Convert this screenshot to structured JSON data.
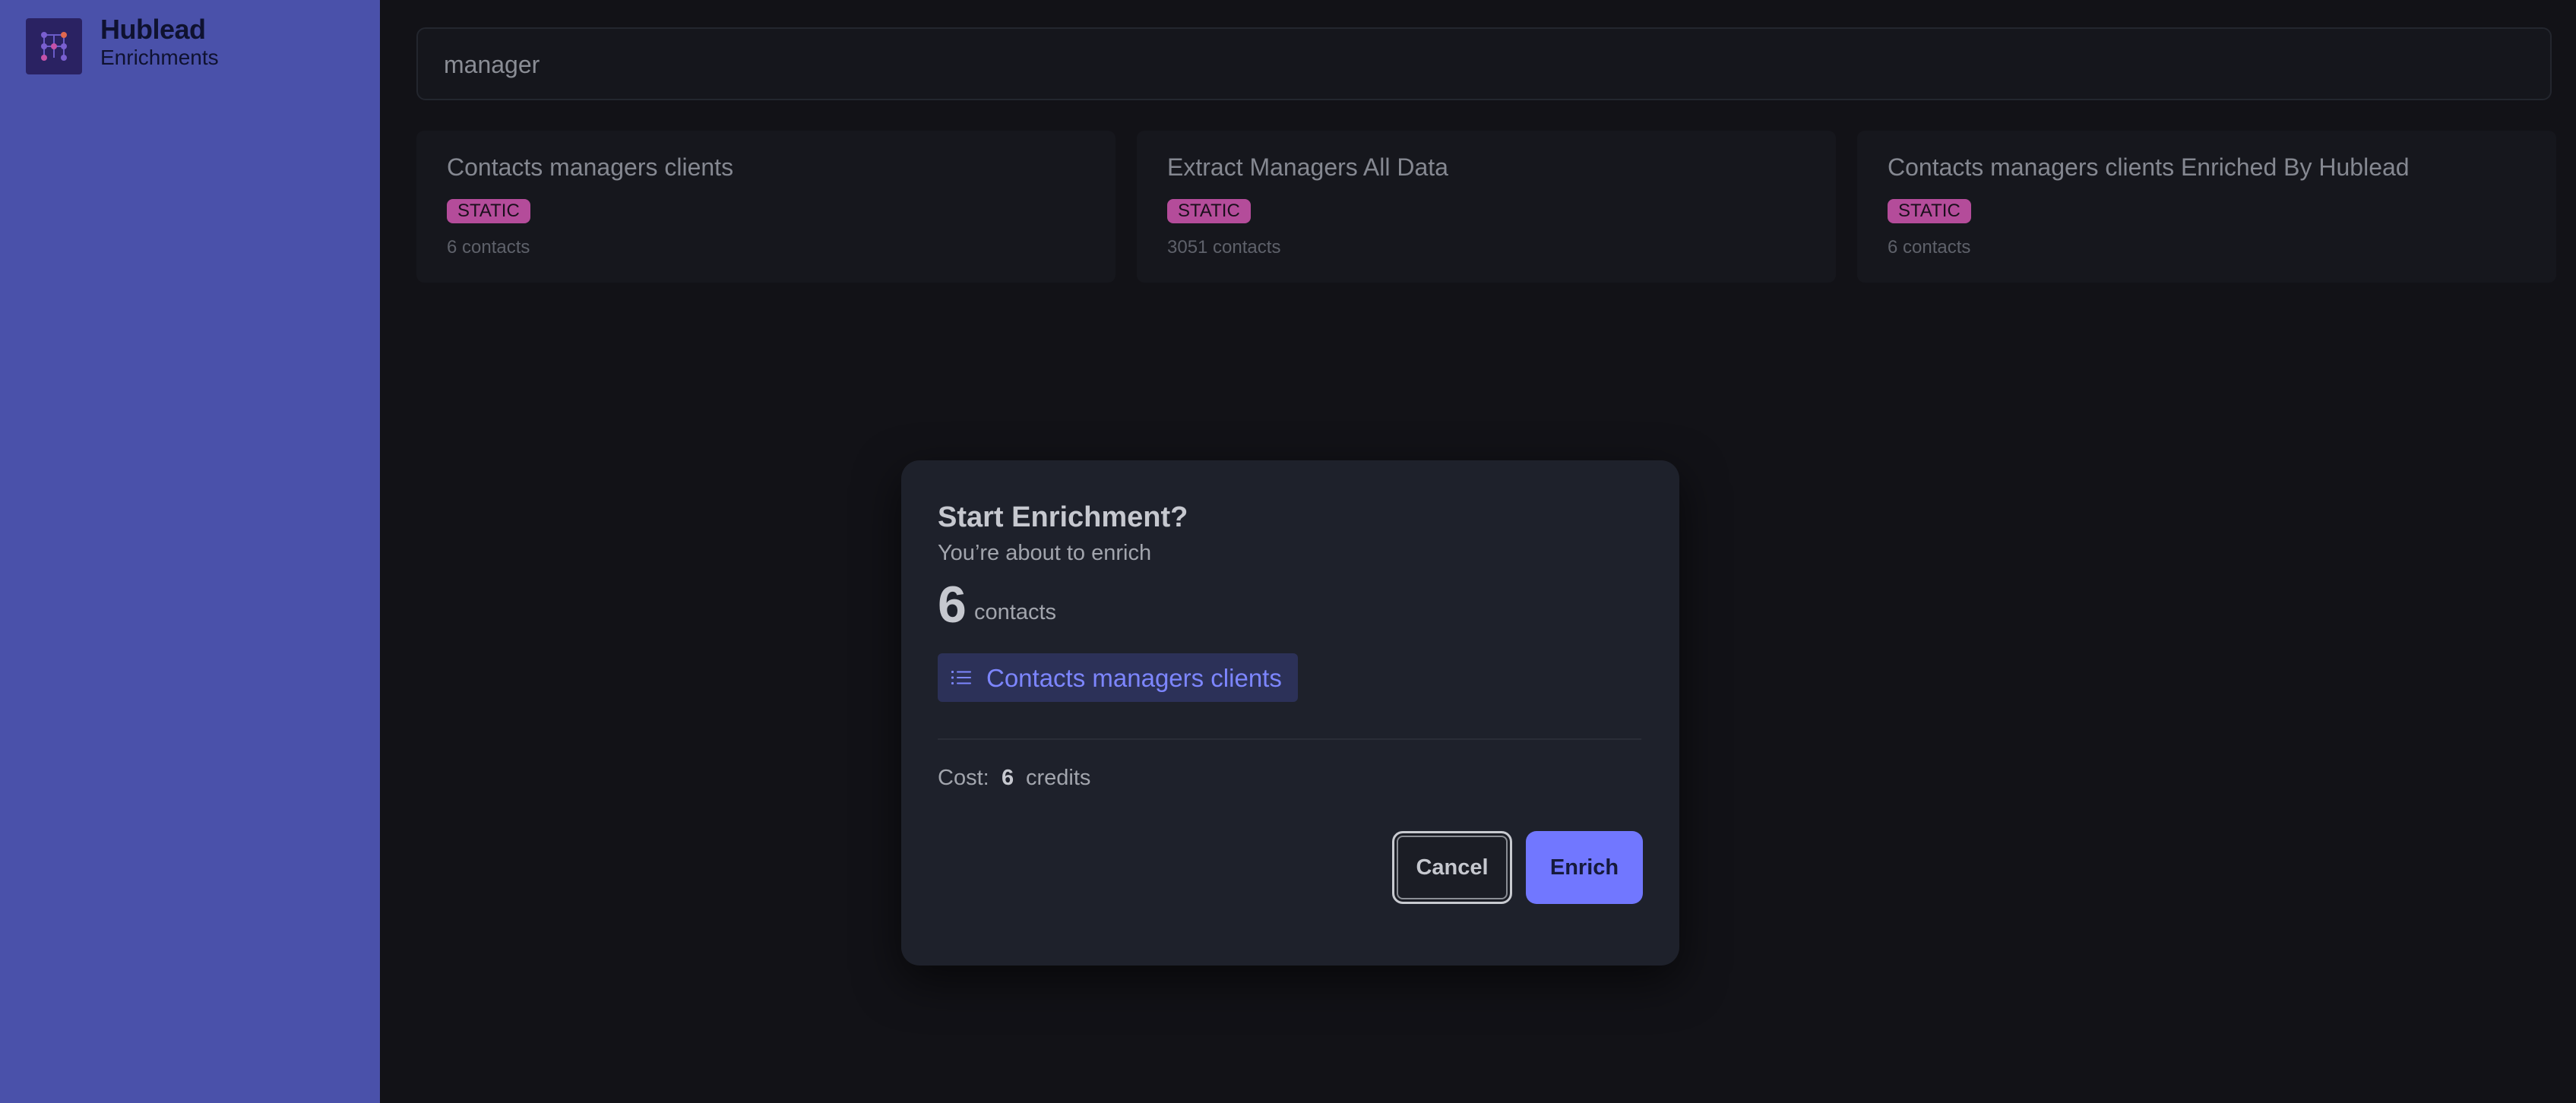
{
  "brand": {
    "name": "Hublead",
    "subtitle": "Enrichments"
  },
  "search": {
    "value": "manager",
    "placeholder": ""
  },
  "cards": [
    {
      "title": "Contacts managers clients",
      "badge": "STATIC",
      "count": "6 contacts"
    },
    {
      "title": "Extract Managers All Data",
      "badge": "STATIC",
      "count": "3051 contacts"
    },
    {
      "title": "Contacts managers clients Enriched By Hublead",
      "badge": "STATIC",
      "count": "6 contacts"
    }
  ],
  "modal": {
    "title": "Start Enrichment?",
    "subtitle": "You’re about to enrich",
    "count": "6",
    "count_label": "contacts",
    "list_name": "Contacts managers clients",
    "cost_label": "Cost:",
    "cost_value": "6",
    "cost_unit": "credits",
    "cancel_label": "Cancel",
    "enrich_label": "Enrich"
  },
  "colors": {
    "sidebar": "#4a51aa",
    "background": "#121217",
    "badge": "#b44c9a",
    "accent": "#7177ff"
  },
  "icons": {
    "logo": "hublead-logo",
    "list": "list-icon"
  }
}
